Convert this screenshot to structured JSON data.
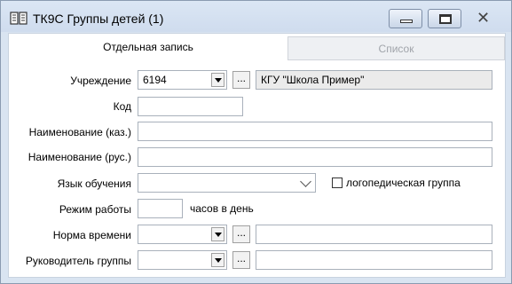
{
  "window": {
    "title": "ТК9С Группы детей (1)",
    "minimize_label": "",
    "maximize_label": "",
    "close_glyph": "✕"
  },
  "tabs": [
    {
      "label": "Отдельная запись",
      "active": true
    },
    {
      "label": "Список",
      "active": false
    }
  ],
  "form": {
    "institution": {
      "label": "Учреждение",
      "code": "6194",
      "name": "КГУ \"Школа Пример\"",
      "ellipsis": "..."
    },
    "code": {
      "label": "Код",
      "value": ""
    },
    "name_kaz": {
      "label": "Наименование (каз.)",
      "value": ""
    },
    "name_rus": {
      "label": "Наименование (рус.)",
      "value": ""
    },
    "language": {
      "label": "Язык обучения",
      "value": ""
    },
    "speech_group": {
      "label": "логопедическая группа",
      "checked": false
    },
    "work_mode": {
      "label": "Режим работы",
      "value": "",
      "suffix": "часов в день"
    },
    "time_norm": {
      "label": "Норма времени",
      "value": "",
      "text": "",
      "ellipsis": "..."
    },
    "group_leader": {
      "label": "Руководитель группы",
      "value": "",
      "text": "",
      "ellipsis": "..."
    }
  }
}
